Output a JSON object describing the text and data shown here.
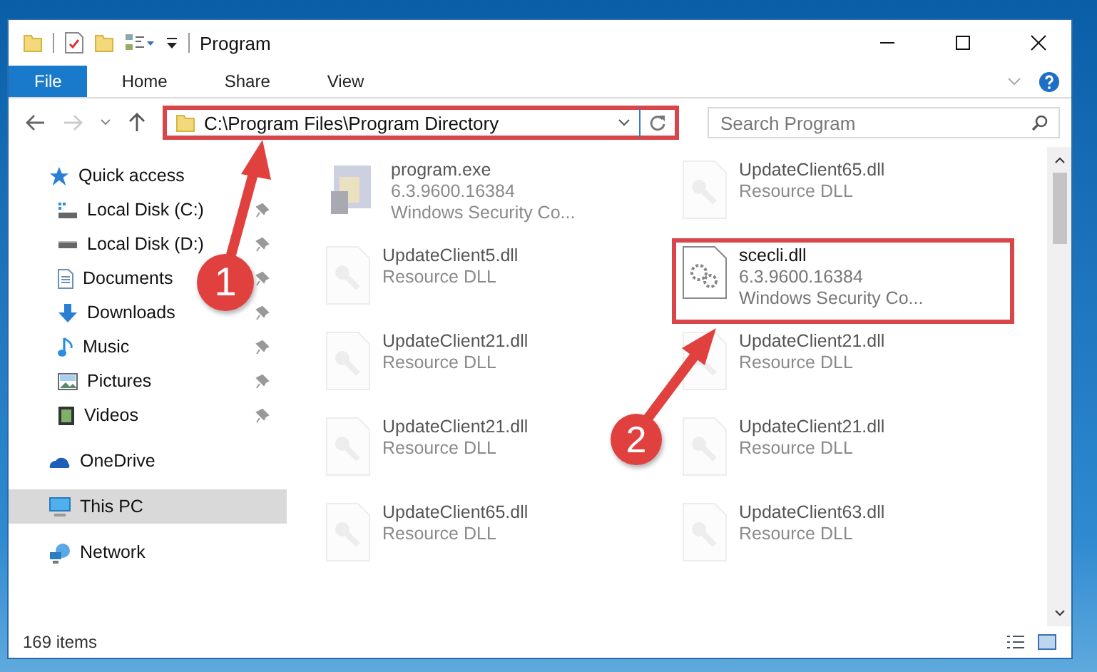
{
  "window": {
    "title": "Program"
  },
  "ribbon_tabs": [
    {
      "label": "File",
      "selected": true
    },
    {
      "label": "Home",
      "selected": false
    },
    {
      "label": "Share",
      "selected": false
    },
    {
      "label": "View",
      "selected": false
    }
  ],
  "address": {
    "path": "C:\\Program Files\\Program Directory",
    "highlighted": true
  },
  "search": {
    "placeholder": "Search Program"
  },
  "sidebar": {
    "items": [
      {
        "label": "Quick access",
        "kind": "star",
        "selected": false,
        "children": [
          {
            "label": "Local Disk (C:)",
            "kind": "sysdrive",
            "pinned": true
          },
          {
            "label": "Local Disk (D:)",
            "kind": "drive",
            "pinned": true
          },
          {
            "label": "Documents",
            "kind": "documents",
            "pinned": true
          },
          {
            "label": "Downloads",
            "kind": "downloads",
            "pinned": true
          },
          {
            "label": "Music",
            "kind": "music",
            "pinned": true
          },
          {
            "label": "Pictures",
            "kind": "pictures",
            "pinned": true
          },
          {
            "label": "Videos",
            "kind": "videos",
            "pinned": true
          }
        ]
      },
      {
        "label": "OneDrive",
        "kind": "cloud",
        "selected": false
      },
      {
        "label": "This PC",
        "kind": "pc",
        "selected": true
      },
      {
        "label": "Network",
        "kind": "network",
        "selected": false
      }
    ]
  },
  "files": [
    {
      "name": "program.exe",
      "lines": [
        "6.3.9600.16384",
        "Windows Security Co..."
      ],
      "kind": "exe",
      "blurred": true,
      "highlighted": false
    },
    {
      "name": "UpdateClient65.dll",
      "lines": [
        "Resource DLL"
      ],
      "kind": "resource",
      "blurred": true,
      "highlighted": false
    },
    {
      "name": "UpdateClient5.dll",
      "lines": [
        "Resource DLL"
      ],
      "kind": "resource",
      "blurred": true,
      "highlighted": false
    },
    {
      "name": "scecli.dll",
      "lines": [
        "6.3.9600.16384",
        "Windows Security Co..."
      ],
      "kind": "system",
      "blurred": false,
      "highlighted": true
    },
    {
      "name": "UpdateClient21.dll",
      "lines": [
        "Resource DLL"
      ],
      "kind": "resource",
      "blurred": true,
      "highlighted": false
    },
    {
      "name": "UpdateClient21.dll",
      "lines": [
        "Resource DLL"
      ],
      "kind": "resource",
      "blurred": true,
      "highlighted": false
    },
    {
      "name": "UpdateClient21.dll",
      "lines": [
        "Resource DLL"
      ],
      "kind": "resource",
      "blurred": true,
      "highlighted": false
    },
    {
      "name": "UpdateClient21.dll",
      "lines": [
        "Resource DLL"
      ],
      "kind": "resource",
      "blurred": true,
      "highlighted": false
    },
    {
      "name": "UpdateClient65.dll",
      "lines": [
        "Resource DLL"
      ],
      "kind": "resource",
      "blurred": true,
      "highlighted": false
    },
    {
      "name": "UpdateClient63.dll",
      "lines": [
        "Resource DLL"
      ],
      "kind": "resource",
      "blurred": true,
      "highlighted": false
    }
  ],
  "status_bar": {
    "count": "169 items"
  },
  "annotations": [
    {
      "number": "1"
    },
    {
      "number": "2"
    }
  ]
}
